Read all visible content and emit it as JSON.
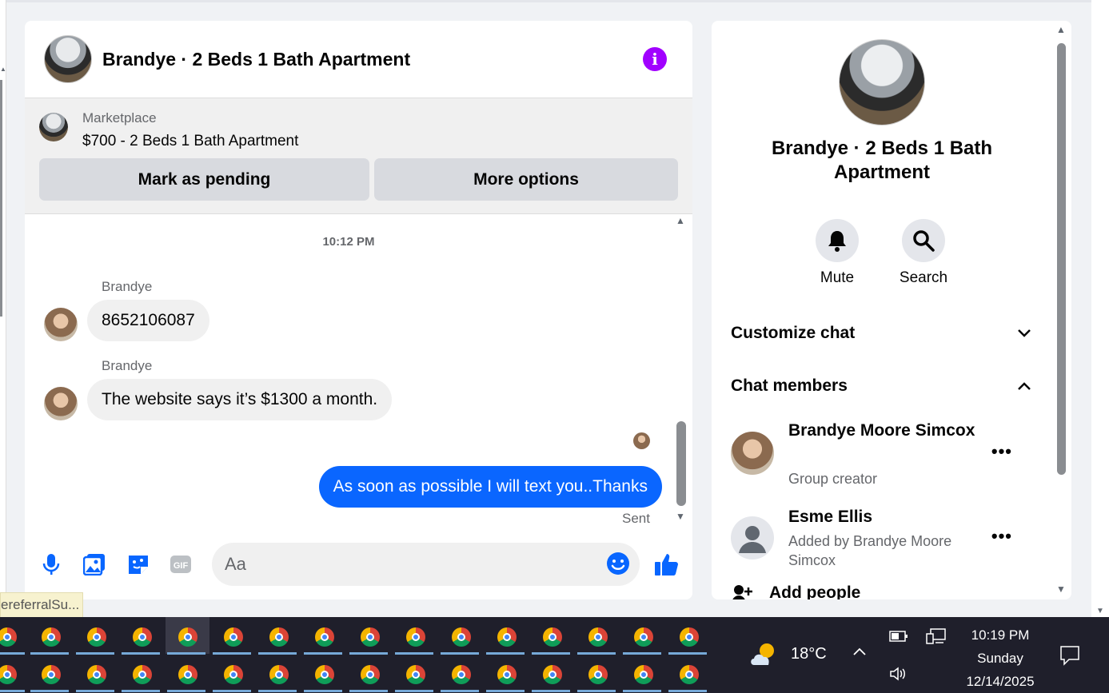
{
  "chat": {
    "title": "Brandye · 2 Beds 1 Bath Apartment",
    "marketplace_label": "Marketplace",
    "listing": "$700 - 2 Beds 1 Bath Apartment",
    "mark_pending": "Mark as pending",
    "more_options": "More options",
    "timestamp": "10:12 PM",
    "messages": [
      {
        "sender": "Brandye",
        "text": "8652106087"
      },
      {
        "sender": "Brandye",
        "text": "The website says it’s $1300 a month."
      },
      {
        "sender": "me",
        "text": "As soon as possible I will text you..Thanks"
      }
    ],
    "status": "Sent",
    "input_placeholder": "Aa"
  },
  "info": {
    "title": "Brandye · 2 Beds 1 Bath Apartment",
    "mute": "Mute",
    "search": "Search",
    "customize": "Customize chat",
    "members_heading": "Chat members",
    "members": [
      {
        "name": "Brandye Moore Simcox",
        "sub": "Group creator"
      },
      {
        "name": "Esme Ellis",
        "sub": "Added by Brandye Moore Simcox"
      }
    ],
    "add_people": "Add people"
  },
  "tooltip": "ereferralSu...",
  "taskbar": {
    "temp": "18°C",
    "time": "10:19 PM",
    "day": "Sunday",
    "date": "12/14/2025"
  },
  "colors": {
    "accent": "#0a66ff",
    "info": "#a100ff",
    "icon_blue": "#0866ff"
  }
}
